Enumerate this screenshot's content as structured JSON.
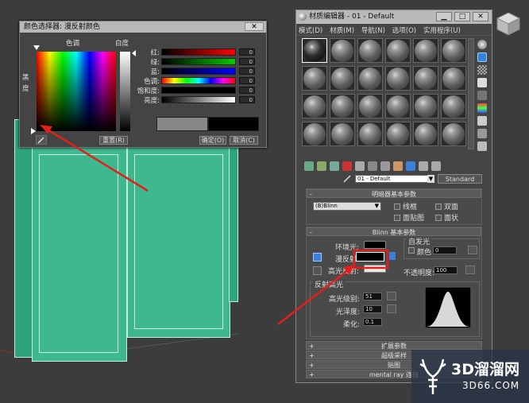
{
  "color_picker": {
    "title": "颜色选择器: 漫反射颜色",
    "close": "✕",
    "hue_label": "色调",
    "whiteness_label": "白度",
    "blackness_label": "黑度",
    "channels": [
      {
        "label": "红:",
        "value": "0"
      },
      {
        "label": "绿:",
        "value": "0"
      },
      {
        "label": "蓝:",
        "value": "0"
      },
      {
        "label": "色调:",
        "value": "0"
      },
      {
        "label": "饱和度:",
        "value": "0"
      },
      {
        "label": "亮度:",
        "value": "0"
      }
    ],
    "reset_button": "重置(R)",
    "ok_button": "确定(O)",
    "cancel_button": "取消(C)"
  },
  "material_editor": {
    "title": "材质编辑器 - 01 - Default",
    "menu": [
      "模式(D)",
      "材质(M)",
      "导航(N)",
      "选项(O)",
      "实用程序(U)"
    ],
    "material_name": "01 - Default",
    "material_type": "Standard",
    "shader_rollout": "明暗器基本参数",
    "shader_value": "(B)Blinn",
    "shader_options": [
      "线框",
      "双面",
      "面贴图",
      "面状"
    ],
    "blinn_rollout": "Blinn 基本参数",
    "self_illum_label": "自发光",
    "color_label": "颜色",
    "self_illum_value": "0",
    "ambient_label": "环境光:",
    "diffuse_label": "漫反射:",
    "specular_label": "高光反射:",
    "opacity_label": "不透明度:",
    "opacity_value": "100",
    "spec_highlights_label": "反射高光",
    "spec_level_label": "高光级别:",
    "spec_level_value": "51",
    "glossiness_label": "光泽度:",
    "glossiness_value": "10",
    "soften_label": "柔化:",
    "soften_value": "0.1",
    "bottom_rollouts": [
      "扩展参数",
      "超级采样",
      "贴图",
      "mental ray 连接"
    ]
  },
  "watermark": {
    "main": "3D溜溜网",
    "sub": "3D66.COM"
  },
  "colors": {
    "accent_red": "#e0201a",
    "door_green": "#3fb890",
    "highlight_blue": "#3a7fd8"
  },
  "icons": [
    "close-icon",
    "eyedropper-icon",
    "material-sphere-icon",
    "navigation-cube-icon"
  ]
}
